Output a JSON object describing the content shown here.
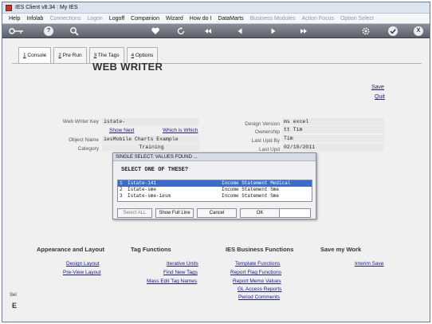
{
  "window": {
    "title": "IES Client v8.34 : My IES"
  },
  "menu": [
    {
      "label": "Help",
      "enabled": true
    },
    {
      "label": "Infolab",
      "enabled": true
    },
    {
      "label": "Connections",
      "enabled": false
    },
    {
      "label": "Logon",
      "enabled": false
    },
    {
      "label": "Logoff",
      "enabled": true
    },
    {
      "label": "Companion",
      "enabled": true
    },
    {
      "label": "Wizard",
      "enabled": true
    },
    {
      "label": "How do I",
      "enabled": true
    },
    {
      "label": "DataMarts",
      "enabled": true
    },
    {
      "label": "Business Modules",
      "enabled": false
    },
    {
      "label": "Action Focus",
      "enabled": false
    },
    {
      "label": "Option Select",
      "enabled": false
    }
  ],
  "toolbar": {
    "icons": [
      "key-icon",
      "help-icon",
      "search-icon",
      "heart-icon",
      "refresh-icon",
      "rewind-icon",
      "back-icon",
      "forward-icon",
      "fast-forward-icon",
      "settings-icon",
      "check-icon",
      "close-icon"
    ],
    "help_glyph": "?",
    "close_glyph": "X"
  },
  "tabs": [
    {
      "key": "1",
      "label": " Console"
    },
    {
      "key": "2",
      "label": " Pre Run"
    },
    {
      "key": "3",
      "label": " The Tags"
    },
    {
      "key": "4",
      "label": " Options"
    }
  ],
  "page": {
    "title": "WEB WRITER",
    "save": "Save",
    "quit": "Quit"
  },
  "form": {
    "key_label": "Web Writer Key",
    "key_value": "istate-",
    "show_next": "Show Next",
    "which_is_which": "Which is Which",
    "object_name_label": "Object Name",
    "object_name_value": "iesMobile Charts Example",
    "category_label": "Category",
    "category_value": "Training",
    "design_version_label": "Design Version",
    "design_version_value": "ms excel",
    "ownership_label": "Ownership",
    "ownership_value": "tt Tim",
    "last_upd_by_label": "Last Upd By",
    "last_upd_by_value": "Tim",
    "last_upd_label": "Last Upd",
    "last_upd_value": "02/10/2011"
  },
  "dialog": {
    "title": "SINGLE SELECT: VALUES FOUND ...",
    "prompt": "SELECT ONE OF THESE?",
    "rows": [
      {
        "n": "1",
        "key": "Istate-141",
        "desc": "Income Statement Medical"
      },
      {
        "n": "2",
        "key": "Istate-sme",
        "desc": "Income Statement Sme"
      },
      {
        "n": "3",
        "key": "Istate-sme-iesm",
        "desc": "Income Statement Sme"
      }
    ],
    "buttons": {
      "select_all": "Select ALL",
      "show_full_line": "Show Full Line",
      "cancel": "Cancel",
      "ok": "OK"
    }
  },
  "sections": {
    "appearance": {
      "title": "Appearance and Layout",
      "links": [
        "Design Layout",
        "Pre-View Layout"
      ]
    },
    "tag_functions": {
      "title": "Tag Functions",
      "links": [
        "Iterative Units",
        "Find New Tags",
        "Mass Edit Tag Names"
      ]
    },
    "ies_business": {
      "title": "IES Business Functions",
      "links": [
        "Template Functions",
        "Report Flag Functions",
        "Report Memo Values",
        "GL Access Reports",
        "Period Comments"
      ]
    },
    "save_work": {
      "title": "Save my Work",
      "links": [
        "Interim Save"
      ]
    }
  },
  "sidebar": {
    "fragment": "Sel",
    "letter": "E"
  }
}
